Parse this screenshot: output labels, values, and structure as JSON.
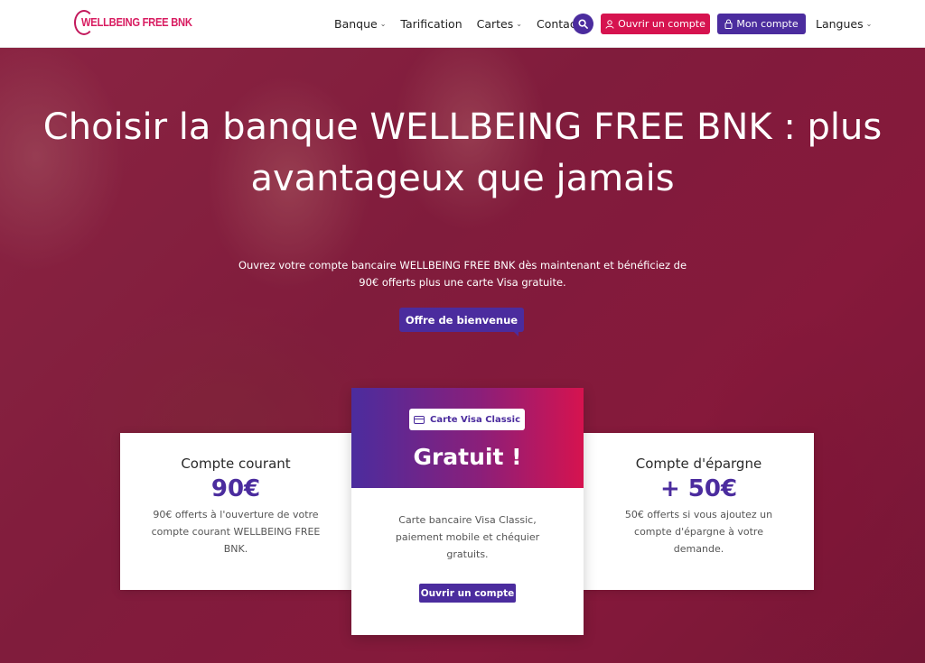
{
  "brand": {
    "name": "WELLBEING FREE BNK",
    "primary_color": "#4b2c9e",
    "accent_color": "#d6134f"
  },
  "nav": {
    "items": [
      {
        "label": "Banque",
        "dropdown": true
      },
      {
        "label": "Tarification",
        "dropdown": false
      },
      {
        "label": "Cartes",
        "dropdown": true
      },
      {
        "label": "Contact",
        "dropdown": false
      }
    ],
    "search_icon": "search-icon",
    "open_account_label": "Ouvrir un compte",
    "open_account_icon": "user-icon",
    "my_account_label": "Mon compte",
    "my_account_icon": "lock-icon",
    "language_label": "Langues"
  },
  "hero": {
    "title_line1": "Choisir la banque WELLBEING FREE BNK : plus",
    "title_line2": "avantageux que jamais",
    "subtitle": "Ouvrez votre compte bancaire WELLBEING FREE BNK dès maintenant et bénéficiez de 90€ offerts plus une carte Visa gratuite.",
    "cta_label": "Offre de bienvenue"
  },
  "cards": {
    "left": {
      "heading": "Compte courant",
      "price": "90€",
      "description": "90€ offerts à l'ouverture de votre compte courant WELLBEING FREE BNK."
    },
    "center": {
      "badge_label": "Carte Visa Classic",
      "badge_icon": "credit-card-icon",
      "headline": "Gratuit !",
      "description": "Carte bancaire Visa Classic, paiement mobile et chéquier gratuits.",
      "button_label": "Ouvrir un compte"
    },
    "right": {
      "heading": "Compte d'épargne",
      "price": "+ 50€",
      "description": "50€ offerts si vous ajoutez un compte d'épargne à votre demande."
    }
  }
}
